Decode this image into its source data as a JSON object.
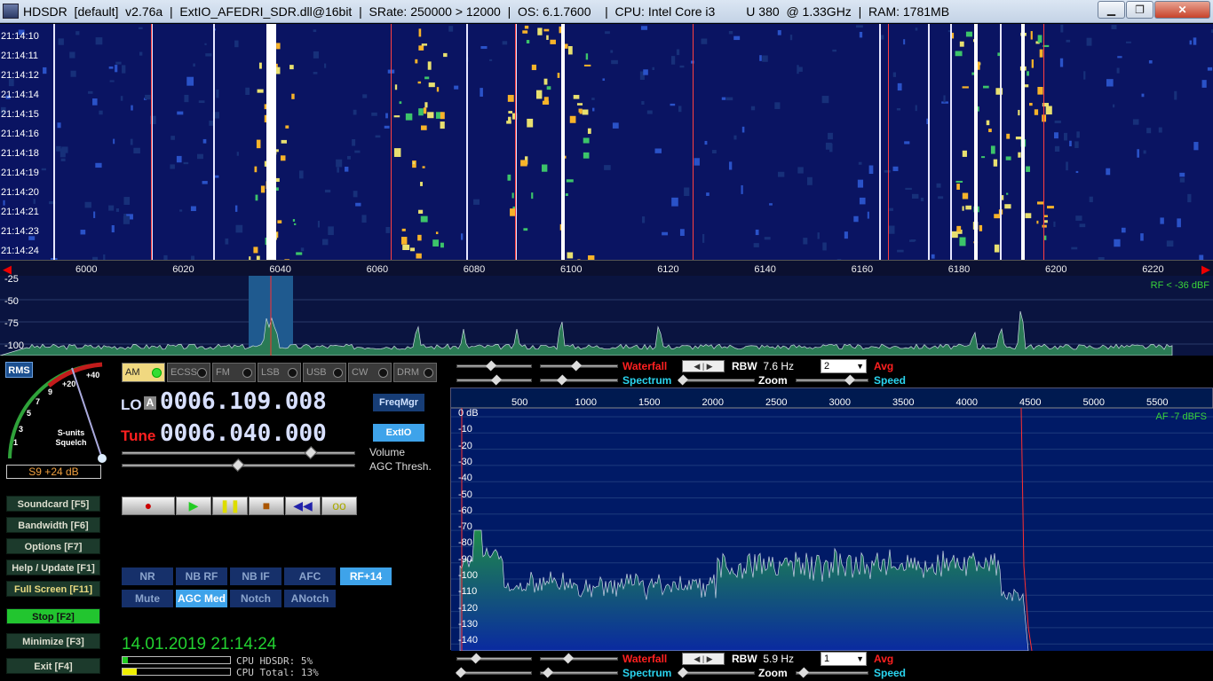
{
  "window": {
    "title": "HDSDR  [default]  v2.76a  |  ExtIO_AFEDRI_SDR.dll@16bit  |  SRate: 250000 > 12000  |  OS: 6.1.7600    |  CPU: Intel Core i3         U 380  @ 1.33GHz  |  RAM: 1781MB",
    "minimize_label": "▁",
    "maximize_label": "❐",
    "close_label": "✕"
  },
  "waterfall": {
    "timestamps": [
      "21:14:10",
      "21:14:11",
      "21:14:12",
      "21:14:14",
      "21:14:15",
      "21:14:16",
      "21:14:18",
      "21:14:19",
      "21:14:20",
      "21:14:21",
      "21:14:23",
      "21:14:24"
    ]
  },
  "rf_axis": {
    "ticks": [
      "6000",
      "6020",
      "6040",
      "6060",
      "6080",
      "6100",
      "6120",
      "6140",
      "6160",
      "6180",
      "6200",
      "6220"
    ]
  },
  "rf_spectrum": {
    "db_labels": [
      "-25",
      "-50",
      "-75",
      "-100"
    ],
    "rf_level": "RF < -36 dBF"
  },
  "smeter": {
    "rms_label": "RMS",
    "scale": [
      "1",
      "3",
      "5",
      "7",
      "9",
      "+20",
      "+40"
    ],
    "caption_line1": "S-units",
    "caption_line2": "Squelch",
    "value": "S9 +24 dB"
  },
  "modes": [
    "AM",
    "ECSS",
    "FM",
    "LSB",
    "USB",
    "CW",
    "DRM"
  ],
  "lo": {
    "label": "LO",
    "badge": "A",
    "freq": "0006.109.008"
  },
  "tune": {
    "label": "Tune",
    "freq": "0006.040.000"
  },
  "buttons": {
    "freqmgr": "FreqMgr",
    "extio": "ExtIO"
  },
  "sliders": {
    "volume_label": "Volume",
    "agc_label": "AGC Thresh."
  },
  "transport": [
    "●",
    "▶",
    "❚❚",
    "■",
    "◀◀",
    "oo"
  ],
  "dsp": {
    "row1": [
      "NR",
      "NB RF",
      "NB IF",
      "AFC",
      "RF+14"
    ],
    "row2": [
      "Mute",
      "AGC Med",
      "Notch",
      "ANotch"
    ]
  },
  "function_keys": [
    {
      "label": "Soundcard  [F5]"
    },
    {
      "label": "Bandwidth  [F6]"
    },
    {
      "label": "Options  [F7]"
    },
    {
      "label": "Help / Update  [F1]"
    },
    {
      "label": "Full Screen  [F11]"
    },
    {
      "label": "Stop    [F2]"
    },
    {
      "label": "Minimize  [F3]"
    },
    {
      "label": "Exit    [F4]"
    }
  ],
  "status": {
    "datetime": "14.01.2019 21:14:24",
    "cpu_hdsdr_label": "CPU HDSDR:  5%",
    "cpu_total_label": "CPU Total: 13%",
    "cpu_hdsdr_pct": 5,
    "cpu_total_pct": 13
  },
  "rf_controls": {
    "waterfall": "Waterfall",
    "spectrum": "Spectrum",
    "rbw_label": "RBW",
    "rbw_value": "7.6 Hz",
    "avg_value": "2",
    "avg_label": "Avg",
    "zoom_label": "Zoom",
    "speed_label": "Speed"
  },
  "af_controls": {
    "waterfall": "Waterfall",
    "spectrum": "Spectrum",
    "rbw_label": "RBW",
    "rbw_value": "5.9 Hz",
    "avg_value": "1",
    "avg_label": "Avg",
    "zoom_label": "Zoom",
    "speed_label": "Speed"
  },
  "af_spectrum": {
    "x_ticks": [
      "500",
      "1000",
      "1500",
      "2000",
      "2500",
      "3000",
      "3500",
      "4000",
      "4500",
      "5000",
      "5500"
    ],
    "db_labels": [
      "0 dB",
      "-10",
      "-20",
      "-30",
      "-40",
      "-50",
      "-60",
      "-70",
      "-80",
      "-90",
      "-100",
      "-110",
      "-120",
      "-130",
      "-140"
    ],
    "af_level": "AF  -7 dBFS"
  },
  "colors": {
    "waterfall_red": "#e00000",
    "spectrum_cyan": "#2ad4ef",
    "accent_green": "#22d030"
  }
}
